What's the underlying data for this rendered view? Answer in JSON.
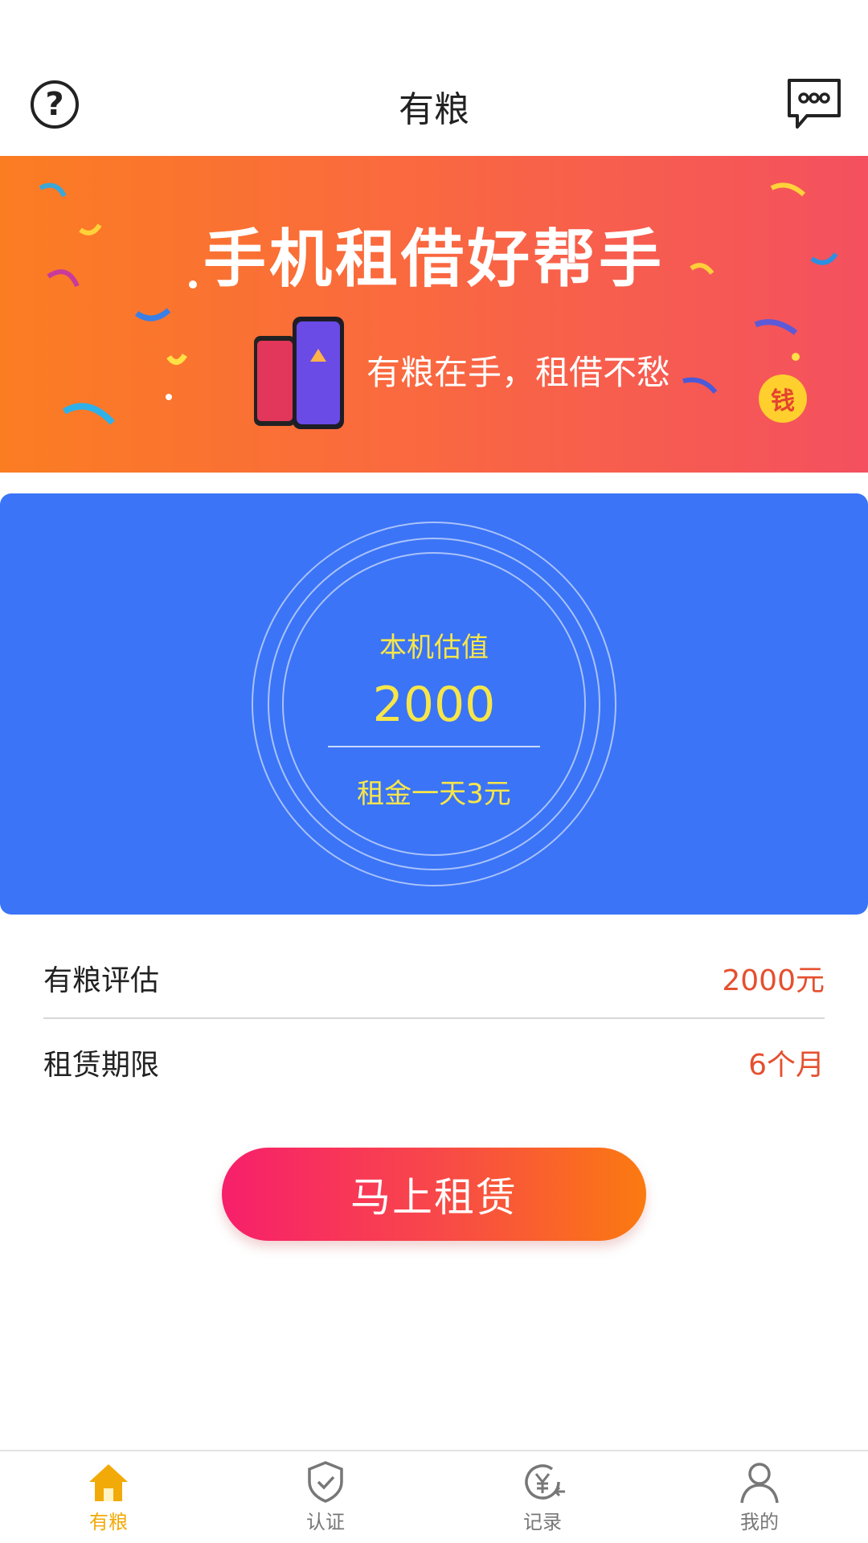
{
  "header": {
    "title": "有粮",
    "help_icon": "question-circle-icon",
    "message_icon": "chat-bubble-icon"
  },
  "banner": {
    "headline": "手机租借好帮手",
    "subtitle": "有粮在手，租借不愁",
    "coin_text": "钱",
    "colors": {
      "start": "#fb7d22",
      "end": "#f4505f"
    }
  },
  "valuation": {
    "label": "本机估值",
    "amount": "2000",
    "rent": "租金一天3元",
    "card_color": "#3b74f6",
    "text_color": "#f7e64a"
  },
  "details": [
    {
      "key": "有粮评估",
      "value": "2000元"
    },
    {
      "key": "租赁期限",
      "value": "6个月"
    }
  ],
  "cta": {
    "label": "马上租赁"
  },
  "tabbar": {
    "active_color": "#f2aa09",
    "items": [
      {
        "label": "有粮",
        "icon": "home-icon",
        "active": true
      },
      {
        "label": "认证",
        "icon": "shield-check-icon",
        "active": false
      },
      {
        "label": "记录",
        "icon": "yen-history-icon",
        "active": false
      },
      {
        "label": "我的",
        "icon": "user-icon",
        "active": false
      }
    ]
  }
}
